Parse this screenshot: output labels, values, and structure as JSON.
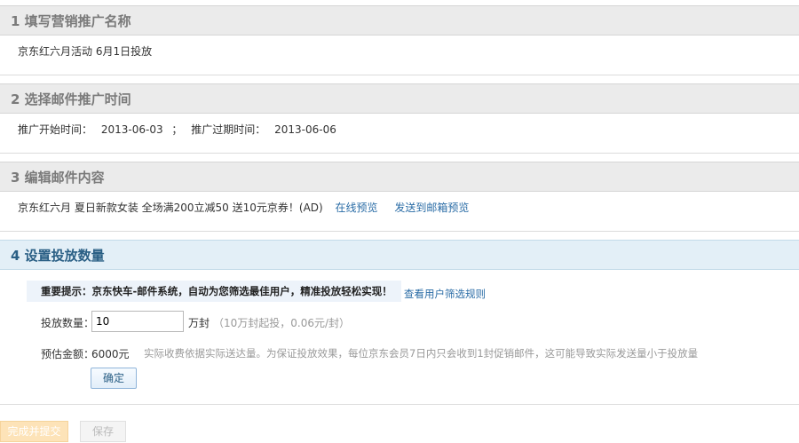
{
  "sections": [
    {
      "title": "1 填写营销推广名称",
      "content": "京东红六月活动 6月1日投放"
    },
    {
      "title": "2 选择邮件推广时间",
      "start_label": "推广开始时间：",
      "start_value": "2013-06-03",
      "separator": "；",
      "end_label": "推广过期时间：",
      "end_value": "2013-06-06"
    },
    {
      "title": "3 编辑邮件内容",
      "subject": "京东红六月 夏日新款女装 全场满200立减50 送10元京券！(AD)",
      "preview_link": "在线预览",
      "send_preview_link": "发送到邮箱预览"
    },
    {
      "title": "4 设置投放数量",
      "notice": "重要提示：京东快车-邮件系统，自动为您筛选最佳用户，精准投放轻松实现！",
      "rule_link": "查看用户筛选规则",
      "qty_label": "投放数量：",
      "qty_value": "10",
      "qty_unit": "万封",
      "qty_hint": "（10万封起投，0.06元/封）",
      "amount_label": "预估金额：",
      "amount_value": "6000元",
      "amount_note": "实际收费依据实际送达量。为保证投放效果，每位京东会员7日内只会收到1封促销邮件，这可能导致实际发送量小于投放量",
      "confirm_label": "确定"
    }
  ],
  "footer": {
    "submit_label": "完成并提交",
    "save_label": "保存"
  },
  "colors": {
    "active_header_bg": "#e3eff7",
    "link": "#2a6ca6",
    "submit_bg": "#fde3b8"
  }
}
